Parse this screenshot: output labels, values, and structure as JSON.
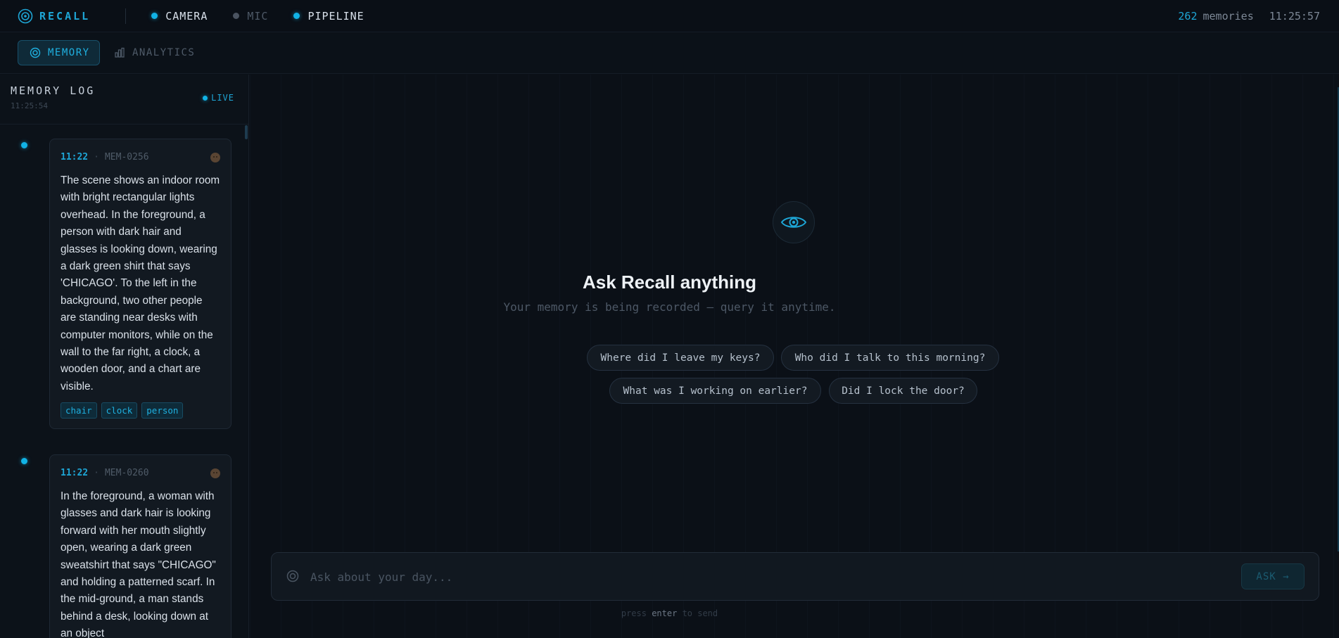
{
  "app": {
    "name": "RECALL",
    "memory_count": "262",
    "memory_word": "memories",
    "clock": "11:25:57"
  },
  "status": [
    {
      "label": "CAMERA",
      "state": "on"
    },
    {
      "label": "MIC",
      "state": "off"
    },
    {
      "label": "PIPELINE",
      "state": "on"
    }
  ],
  "nav": {
    "tabs": [
      {
        "label": "MEMORY",
        "active": true,
        "icon": "target-icon"
      },
      {
        "label": "ANALYTICS",
        "active": false,
        "icon": "bar-chart-icon"
      }
    ]
  },
  "sidebar": {
    "title": "MEMORY LOG",
    "time": "11:25:54",
    "live_label": "LIVE",
    "cards": [
      {
        "time": "11:22",
        "sep": "·",
        "id": "MEM-0256",
        "text": "The scene shows an indoor room with bright rectangular lights overhead. In the foreground, a person with dark hair and glasses is looking down, wearing a dark green shirt that says 'CHICAGO'. To the left in the background, two other people are standing near desks with computer monitors, while on the wall to the far right, a clock, a wooden door, and a chart are visible.",
        "tags": [
          "chair",
          "clock",
          "person"
        ]
      },
      {
        "time": "11:22",
        "sep": "·",
        "id": "MEM-0260",
        "text": "In the foreground, a woman with glasses and dark hair is looking forward with her mouth slightly open, wearing a dark green sweatshirt that says \"CHICAGO\" and holding a patterned scarf. In the mid-ground, a man stands behind a desk, looking down at an object",
        "tags": []
      }
    ]
  },
  "main": {
    "hero_icon": "eye-icon",
    "title": "Ask Recall anything",
    "subtitle": "Your memory is being recorded — query it anytime.",
    "suggestions": [
      "Where did I leave my keys?",
      "Who did I talk to this morning?",
      "What was I working on earlier?",
      "Did I lock the door?"
    ],
    "chat": {
      "placeholder": "Ask about your day...",
      "button_label": "ASK →",
      "hint_pre": "press",
      "hint_key": "enter",
      "hint_post": "to send"
    }
  },
  "colors": {
    "accent": "#1ea6d6",
    "background": "#0b1017",
    "card": "#121921"
  }
}
